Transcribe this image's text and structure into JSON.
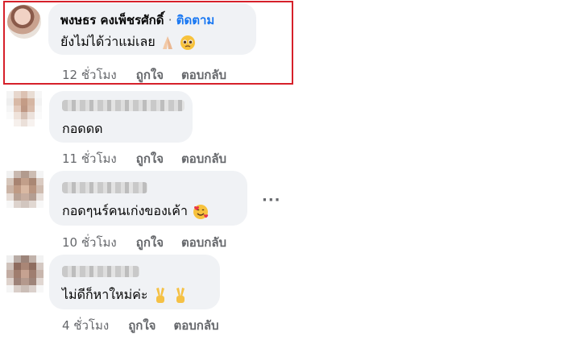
{
  "comments": [
    {
      "author": "พงษธร คงเพ็ชรศักดิ์",
      "separator": "·",
      "follow_label": "ติดตาม",
      "text": "ยังไม่ได้ว่าแม่เลย",
      "emojis": [
        "folded-hands",
        "pleading-face"
      ],
      "time": "12 ชั่วโมง",
      "like_label": "ถูกใจ",
      "reply_label": "ตอบกลับ",
      "highlighted": true
    },
    {
      "author": "",
      "text": "กอดดด",
      "emojis": [],
      "time": "11 ชั่วโมง",
      "like_label": "ถูกใจ",
      "reply_label": "ตอบกลับ"
    },
    {
      "author": "",
      "text": "กอดๆนร์คนเก่งของเค้า",
      "emojis": [
        "smiling-face-with-hearts"
      ],
      "time": "10 ชั่วโมง",
      "like_label": "ถูกใจ",
      "reply_label": "ตอบกลับ",
      "more_label": "···"
    },
    {
      "author": "",
      "text": "ไม่ดีก็หาใหม่ค่ะ",
      "emojis": [
        "victory-hand",
        "victory-hand"
      ],
      "time": "4 ชั่วโมง",
      "like_label": "ถูกใจ",
      "reply_label": "ตอบกลับ"
    }
  ],
  "colors": {
    "highlight_border": "#d6202a",
    "follow": "#1877f2",
    "bubble": "#f0f2f5",
    "meta": "#65676b"
  }
}
